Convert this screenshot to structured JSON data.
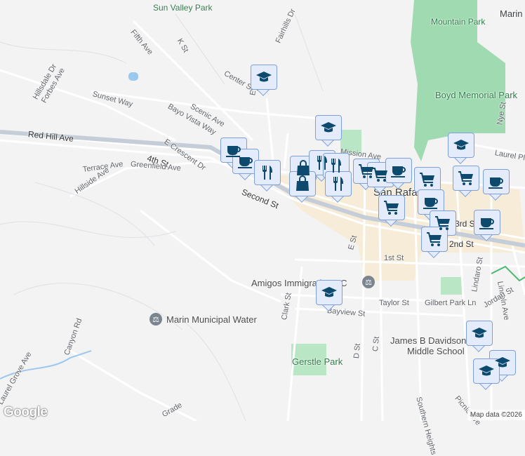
{
  "map": {
    "labels": {
      "sun_valley_park": "Sun Valley Park",
      "fifth_ave": "Fifth Ave",
      "k_st": "K St",
      "fairhills_dr": "Fairhills Dr",
      "mountain_park": "Mountain Park",
      "marin": "Marin",
      "hillsdale_dr": "Hillsdale Dr",
      "forbes_ave": "Forbes Ave",
      "center_st": "Center St",
      "eye_st": "Eye St",
      "sunset_way": "Sunset Way",
      "scenic_ave": "Scenic Ave",
      "bayo_vista_way": "Bayo Vista Way",
      "boyd_park": "Boyd Memorial Park",
      "red_hill_ave": "Red Hill Ave",
      "fourth_st": "4th St",
      "e_crescent_dr": "E Crescent Dr",
      "nye_st": "Nye St",
      "laurel_pl": "Laurel Pl",
      "terrace_ave": "Terrace Ave",
      "greenfield_ave": "Greenfield Ave",
      "hillside_ave": "Hillside Ave",
      "second_st": "Second St",
      "mission_ave": "Mission Ave",
      "san_rafael": "San Rafael",
      "third_st": "3rd St",
      "second_st_e": "2nd St",
      "e_st": "E St",
      "first_st": "1st St",
      "lindaro_st": "Lindaro St",
      "lincoln_ave": "Lincoln Ave",
      "amigos": "Amigos Immigration PC",
      "taylor_st": "Taylor St",
      "gilbert_park_ln": "Gilbert Park Ln",
      "jordan_st": "Jordan St",
      "bayview_st": "Bayview St",
      "clark_st": "Clark St",
      "marin_water": "Marin Municipal Water",
      "canyon_rd": "Canyon Rd",
      "laurel_grove_ave": "Laurel Grove Ave",
      "d_st": "D St",
      "c_st": "C St",
      "james_b": "James B Davidson",
      "middle_school": "Middle School",
      "gerstle_park": "Gerstle Park",
      "southern_heights": "Southern Heights",
      "picnic_ave": "Picnic Ave",
      "grade": "Grade"
    },
    "markers": [
      "coffee",
      "coffee",
      "restaurant",
      "shopping",
      "restaurant",
      "restaurant",
      "shopping",
      "restaurant",
      "cart",
      "cart",
      "coffee",
      "cart",
      "cart",
      "coffee",
      "cart",
      "coffee",
      "cart",
      "coffee",
      "cart",
      "school",
      "school",
      "school",
      "school",
      "school",
      "school",
      "school"
    ],
    "icon_color": "#0d4a6e",
    "logo": "Google",
    "attribution": "Map data ©2026"
  }
}
